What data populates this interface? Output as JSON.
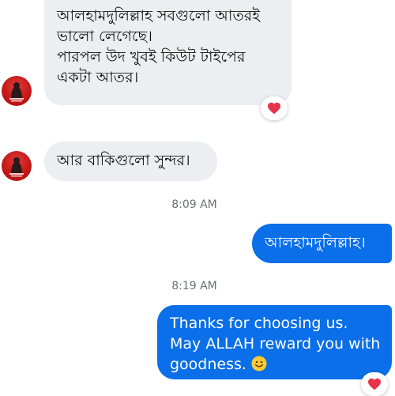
{
  "conversation": {
    "messages": [
      {
        "direction": "incoming",
        "lines": [
          "আলহামদুলিল্লাহ সবগুলো আতরই",
          "ভালো লেগেছে।",
          "পারপল উদ খুবই কিউট টাইপের",
          "একটা আতর।"
        ],
        "reaction": "heart-icon"
      },
      {
        "direction": "incoming",
        "lines": [
          "আর বাকিগুলো সুন্দর।"
        ]
      },
      {
        "direction": "outgoing",
        "lines": [
          "আলহামদুলিল্লাহ।"
        ]
      },
      {
        "direction": "outgoing",
        "lines": [
          "Thanks for choosing us.",
          "May ALLAH reward you with",
          "goodness."
        ],
        "trailing_emoji": "smiling-face-icon",
        "reaction": "heart-icon"
      }
    ],
    "timestamps": [
      "8:09 AM",
      "8:19 AM"
    ]
  },
  "colors": {
    "incoming_bubble": "#eceef2",
    "outgoing_bubble": "#0a6fe8",
    "heart": "#e8334a",
    "avatar": "#c41818"
  }
}
